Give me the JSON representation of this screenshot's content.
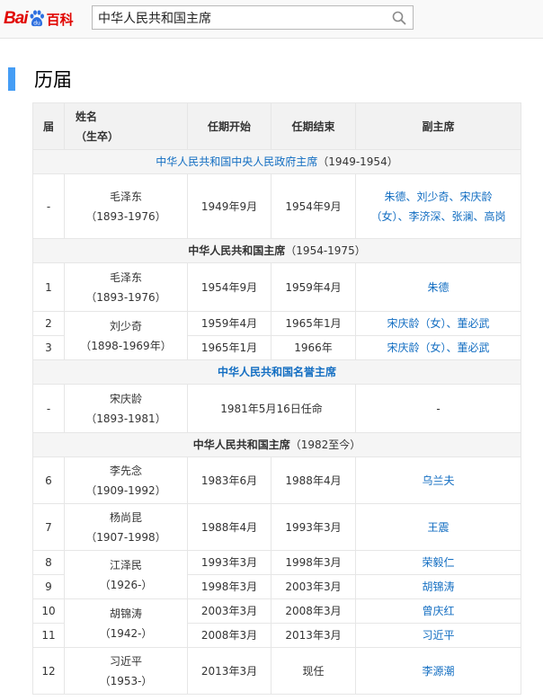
{
  "header": {
    "logo_bai": "Bai",
    "logo_du": "du",
    "logo_baike": "百科",
    "search_value": "中华人民共和国主席"
  },
  "section": {
    "title": "历届"
  },
  "table": {
    "headers": {
      "term": "届",
      "name": "姓名",
      "life": "（生卒）",
      "start": "任期开始",
      "end": "任期结束",
      "vice": "副主席"
    },
    "groups": {
      "g1_title": "中华人民共和国中央人民政府主席",
      "g1_years": "（1949-1954）",
      "g2_title": "中华人民共和国主席",
      "g2_years": "（1954-1975）",
      "g3_title": "中华人民共和国名誉主席",
      "g4_title": "中华人民共和国主席",
      "g4_years": "（1982至今）"
    },
    "rows": {
      "r1": {
        "term": "-",
        "name": "毛泽东",
        "life": "（1893-1976）",
        "start": "1949年9月",
        "end": "1954年9月",
        "vice": "朱德、刘少奇、宋庆龄（女）、李济深、张澜、高岗"
      },
      "r2": {
        "term": "1",
        "name": "毛泽东",
        "life": "（1893-1976）",
        "start": "1954年9月",
        "end": "1959年4月",
        "vice": "朱德"
      },
      "r3": {
        "term": "2",
        "name": "刘少奇",
        "life": "（1898-1969年）",
        "start": "1959年4月",
        "end": "1965年1月",
        "vice": "宋庆龄（女）、董必武"
      },
      "r4": {
        "term": "3",
        "start": "1965年1月",
        "end": "1966年",
        "vice": "宋庆龄（女）、董必武"
      },
      "r5": {
        "term": "-",
        "name": "宋庆龄",
        "life": "（1893-1981）",
        "span": "1981年5月16日任命",
        "vice": "-"
      },
      "r6": {
        "term": "6",
        "name": "李先念",
        "life": "（1909-1992）",
        "start": "1983年6月",
        "end": "1988年4月",
        "vice": "乌兰夫"
      },
      "r7": {
        "term": "7",
        "name": "杨尚昆",
        "life": "（1907-1998）",
        "start": "1988年4月",
        "end": "1993年3月",
        "vice": "王震"
      },
      "r8": {
        "term": "8",
        "name": "江泽民",
        "life": "（1926-）",
        "start": "1993年3月",
        "end": "1998年3月",
        "vice": "荣毅仁"
      },
      "r9": {
        "term": "9",
        "start": "1998年3月",
        "end": "2003年3月",
        "vice": "胡锦涛"
      },
      "r10": {
        "term": "10",
        "name": "胡锦涛",
        "life": "（1942-）",
        "start": "2003年3月",
        "end": "2008年3月",
        "vice": "曾庆红"
      },
      "r11": {
        "term": "11",
        "start": "2008年3月",
        "end": "2013年3月",
        "vice": "习近平"
      },
      "r12": {
        "term": "12",
        "name": "习近平",
        "life": "（1953-）",
        "start": "2013年3月",
        "end": "现任",
        "vice": "李源潮"
      }
    }
  }
}
